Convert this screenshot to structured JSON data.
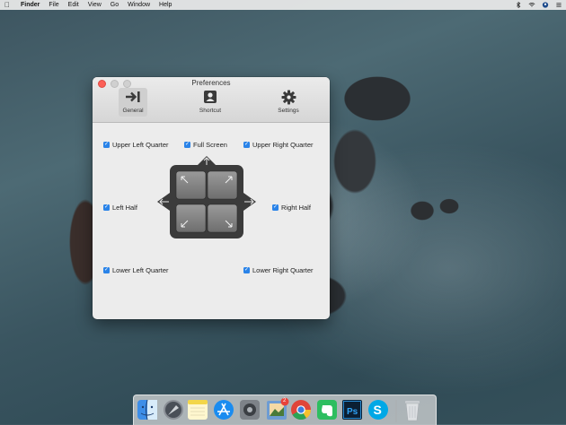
{
  "menubar": {
    "apple_icon": "apple-icon",
    "app_name": "Finder",
    "items": [
      "File",
      "Edit",
      "View",
      "Go",
      "Window",
      "Help"
    ],
    "status_icons": [
      "bluetooth-icon",
      "wifi-icon",
      "user-icon",
      "menu-list-icon"
    ]
  },
  "window": {
    "title": "Preferences",
    "tabs": [
      {
        "label": "General",
        "icon": "arrow-to-bar-icon",
        "selected": true
      },
      {
        "label": "Shortcut",
        "icon": "person-card-icon",
        "selected": false
      },
      {
        "label": "Settings",
        "icon": "gear-icon",
        "selected": false
      }
    ],
    "options": {
      "upper_left_quarter": {
        "label": "Upper Left Quarter",
        "checked": true
      },
      "full_screen": {
        "label": "Full Screen",
        "checked": true
      },
      "upper_right_quarter": {
        "label": "Upper Right Quarter",
        "checked": true
      },
      "left_half": {
        "label": "Left Half",
        "checked": true
      },
      "right_half": {
        "label": "Right Half",
        "checked": true
      },
      "lower_left_quarter": {
        "label": "Lower Left Quarter",
        "checked": true
      },
      "lower_right_quarter": {
        "label": "Lower Right Quarter",
        "checked": true
      }
    },
    "checkmark": "✓"
  },
  "dock": {
    "apps": [
      "Finder",
      "Launchpad",
      "Notes",
      "App Store",
      "System Preferences",
      "Preview",
      "Chrome",
      "Evernote",
      "Photoshop",
      "Skype",
      "Trash"
    ],
    "badge": "2"
  },
  "colors": {
    "accent": "#2a83e8",
    "close": "#fc5f57"
  }
}
